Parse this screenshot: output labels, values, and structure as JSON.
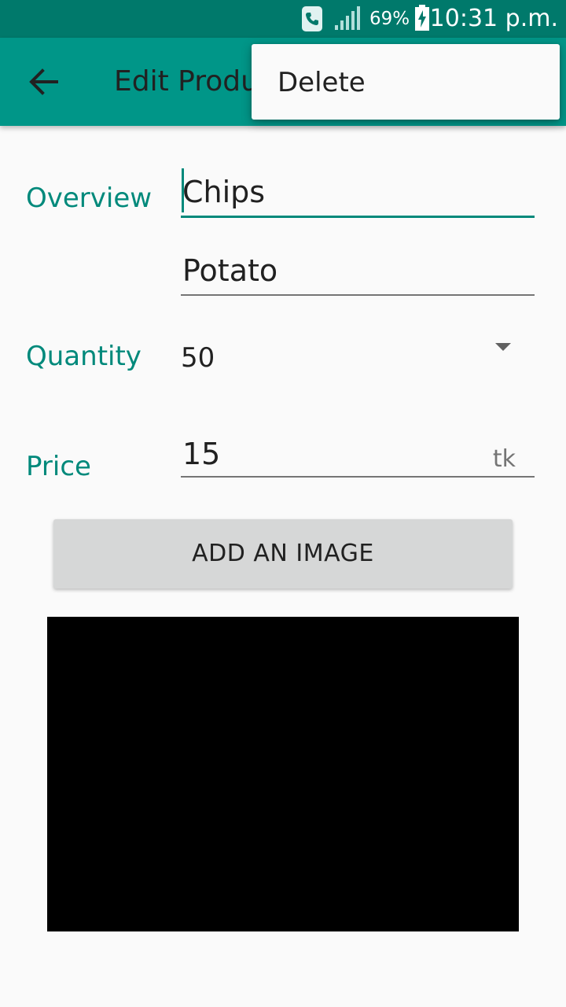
{
  "status_bar": {
    "battery_percent": "69%",
    "time": "10:31 p.m.",
    "icons": [
      "call-icon",
      "signal-icon",
      "battery-charging-icon"
    ]
  },
  "app_bar": {
    "title": "Edit Product",
    "back_icon": "arrow-back-icon",
    "color": "#009688"
  },
  "menu": {
    "items": [
      {
        "label": "Delete"
      }
    ]
  },
  "form": {
    "overview": {
      "label": "Overview",
      "name_value": "Chips",
      "description_value": "Potato"
    },
    "quantity": {
      "label": "Quantity",
      "selected": "50"
    },
    "price": {
      "label": "Price",
      "value": "15",
      "unit": "tk"
    }
  },
  "add_image_button": {
    "label": "ADD AN IMAGE"
  },
  "colors": {
    "accent": "#00897b",
    "status_bar": "#00796b",
    "button": "#d6d7d7"
  }
}
